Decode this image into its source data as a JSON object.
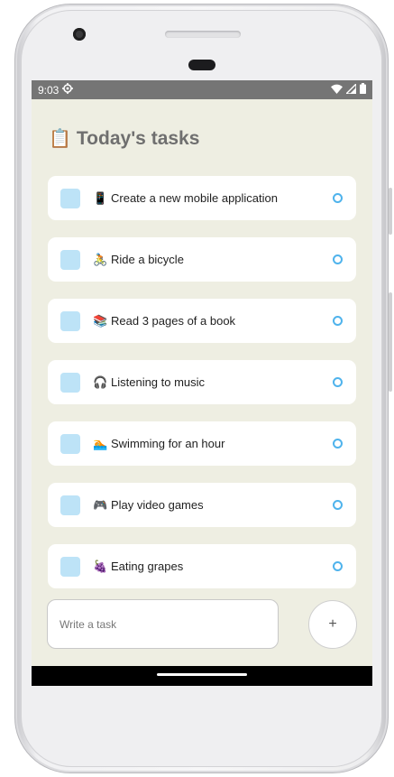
{
  "status_bar": {
    "time": "9:03",
    "left_icon": "settings-gear-icon",
    "right_icons": [
      "wifi-icon",
      "cell-signal-icon",
      "battery-icon"
    ]
  },
  "header": {
    "emoji": "📋",
    "title": "Today's tasks"
  },
  "colors": {
    "background": "#eeeee2",
    "task_square": "#bde3f7",
    "task_circle": "#4fb3ec",
    "title": "#6f6f6f"
  },
  "tasks": [
    {
      "emoji": "📱",
      "text": "Create a new mobile application"
    },
    {
      "emoji": "🚴",
      "text": "Ride a bicycle"
    },
    {
      "emoji": "📚",
      "text": "Read 3 pages of a book"
    },
    {
      "emoji": "🎧",
      "text": "Listening to music"
    },
    {
      "emoji": "🏊",
      "text": "Swimming for an hour"
    },
    {
      "emoji": "🎮",
      "text": "Play video games"
    },
    {
      "emoji": "🍇",
      "text": "Eating grapes"
    }
  ],
  "composer": {
    "placeholder": "Write a task",
    "value": "",
    "add_label": "+"
  }
}
